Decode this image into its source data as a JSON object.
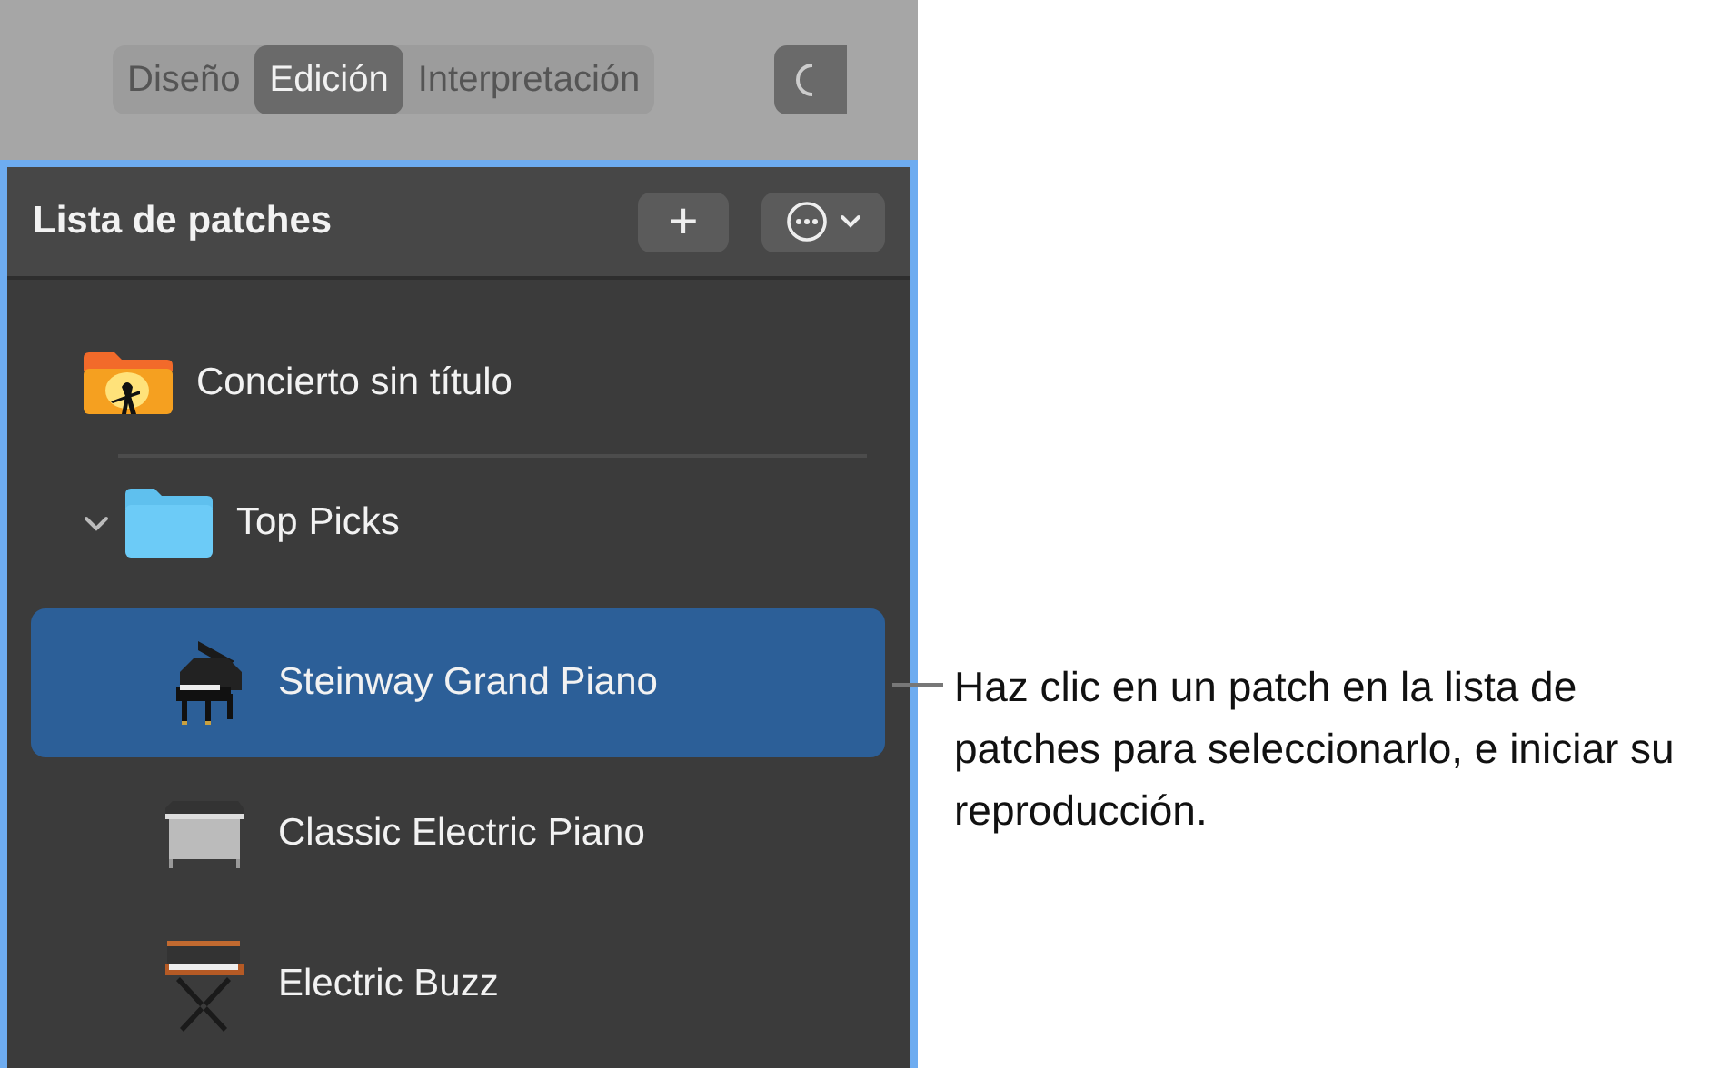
{
  "toolbar": {
    "tabs": [
      {
        "label": "Diseño",
        "selected": false
      },
      {
        "label": "Edición",
        "selected": true
      },
      {
        "label": "Interpretación",
        "selected": false
      }
    ]
  },
  "patch_list": {
    "title": "Lista de patches",
    "add_button": "+",
    "items": [
      {
        "kind": "concert",
        "label": "Concierto sin título",
        "selected": false
      },
      {
        "kind": "folder",
        "label": "Top Picks",
        "expanded": true,
        "selected": false,
        "children": [
          {
            "kind": "grand-piano",
            "label": "Steinway Grand Piano",
            "selected": true
          },
          {
            "kind": "electric-piano",
            "label": "Classic Electric Piano",
            "selected": false
          },
          {
            "kind": "synth",
            "label": "Electric Buzz",
            "selected": false
          }
        ]
      }
    ]
  },
  "callout": {
    "text": "Haz clic en un patch en la lista de patches para seleccionarlo, e iniciar su reproducción."
  }
}
